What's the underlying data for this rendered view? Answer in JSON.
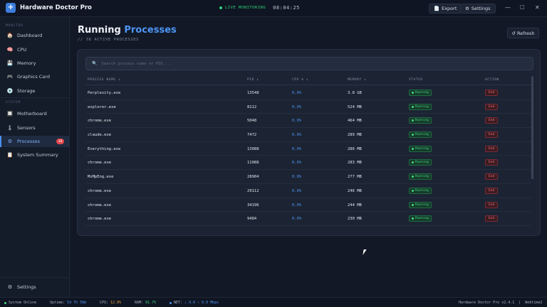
{
  "app": {
    "title": "Hardware Doctor Pro",
    "logo_icon": "stethoscope-icon",
    "live_label": "LIVE MONITORING",
    "clock": "08:04:25",
    "export_label": "Export",
    "settings_label": "Settings"
  },
  "sidebar": {
    "section_monitor": "MONITOR",
    "section_system": "SYSTEM",
    "items_monitor": [
      {
        "label": "Dashboard",
        "icon": "🏠"
      },
      {
        "label": "CPU",
        "icon": "🧠"
      },
      {
        "label": "Memory",
        "icon": "💾"
      },
      {
        "label": "Graphics Card",
        "icon": "🎮"
      },
      {
        "label": "Storage",
        "icon": "💿"
      }
    ],
    "items_system": [
      {
        "label": "Motherboard",
        "icon": "🔲"
      },
      {
        "label": "Sensors",
        "icon": "🌡"
      },
      {
        "label": "Processes",
        "icon": "⚙",
        "badge": "38",
        "active": true
      },
      {
        "label": "System Summary",
        "icon": "📋"
      }
    ],
    "settings_label": "Settings"
  },
  "main": {
    "title_plain": "Running",
    "title_accent": "Processes",
    "subtitle": "// 38 ACTIVE PROCESSES",
    "refresh_label": "↺ Refresh",
    "search_placeholder": "Search process name or PID...",
    "columns": [
      "PROCESS NAME ↕",
      "PID ↕",
      "CPU % ↕",
      "MEMORY ↕",
      "STATUS",
      "ACTION"
    ],
    "rows": [
      {
        "name": "Perplexity.exe",
        "pid": "13548",
        "cpu": "0.0%",
        "memory": "3.8 GB",
        "status": "Running",
        "action": "End"
      },
      {
        "name": "explorer.exe",
        "pid": "8112",
        "cpu": "0.0%",
        "memory": "524 MB",
        "status": "Running",
        "action": "End"
      },
      {
        "name": "chrome.exe",
        "pid": "5048",
        "cpu": "0.0%",
        "memory": "464 MB",
        "status": "Running",
        "action": "End"
      },
      {
        "name": "claude.exe",
        "pid": "7472",
        "cpu": "0.0%",
        "memory": "289 MB",
        "status": "Running",
        "action": "End"
      },
      {
        "name": "Everything.exe",
        "pid": "13088",
        "cpu": "0.0%",
        "memory": "286 MB",
        "status": "Running",
        "action": "End"
      },
      {
        "name": "chrome.exe",
        "pid": "11088",
        "cpu": "0.0%",
        "memory": "283 MB",
        "status": "Running",
        "action": "End"
      },
      {
        "name": "MsMpEng.exe",
        "pid": "28904",
        "cpu": "0.0%",
        "memory": "277 MB",
        "status": "Running",
        "action": "End"
      },
      {
        "name": "chrome.exe",
        "pid": "29112",
        "cpu": "0.0%",
        "memory": "246 MB",
        "status": "Running",
        "action": "End"
      },
      {
        "name": "chrome.exe",
        "pid": "34196",
        "cpu": "0.0%",
        "memory": "244 MB",
        "status": "Running",
        "action": "End"
      },
      {
        "name": "chrome.exe",
        "pid": "9484",
        "cpu": "0.0%",
        "memory": "230 MB",
        "status": "Running",
        "action": "End"
      }
    ]
  },
  "statusbar": {
    "online": "System Online",
    "uptime_label": "Uptime:",
    "uptime_value": "5d 7h 58m",
    "cpu_label": "CPU:",
    "cpu_value": "12.0%",
    "ram_label": "RAM:",
    "ram_value": "91.7%",
    "net_label": "NET:",
    "net_value": "↓ 0.0 ↑ 0.0 Mbps",
    "version": "Hardware Doctor Pro v2.4.1",
    "separator": "|",
    "user": "Webtime2"
  }
}
